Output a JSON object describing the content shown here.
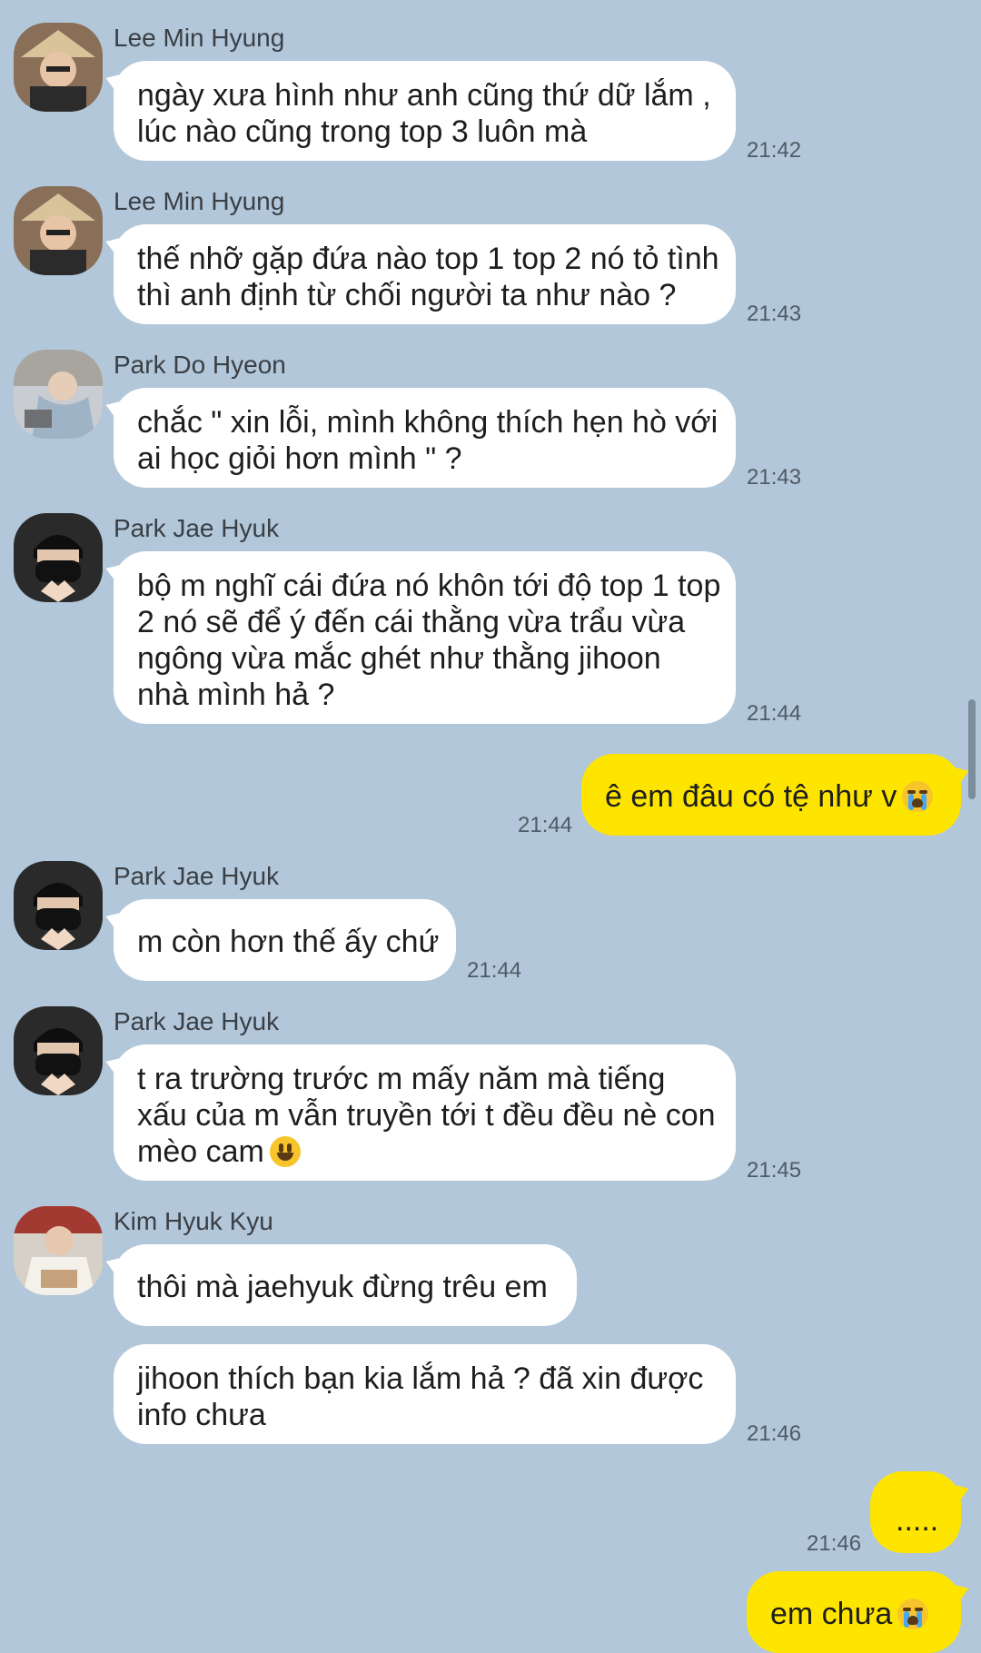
{
  "messages": [
    {
      "sender": "Lee Min Hyung",
      "lines": [
        "ngày xưa hình như anh cũng thứ dữ lắm ,",
        "lúc nào cũng trong top 3 luôn mà"
      ],
      "time": "21:42"
    },
    {
      "sender": "Lee Min Hyung",
      "lines": [
        "thế nhỡ gặp đứa nào top 1 top 2 nó tỏ tình",
        "thì anh định từ chối người ta như nào ?"
      ],
      "time": "21:43"
    },
    {
      "sender": "Park Do Hyeon",
      "lines": [
        "chắc \" xin lỗi, mình không thích hẹn hò với",
        "ai học giỏi hơn mình \" ?"
      ],
      "time": "21:43"
    },
    {
      "sender": "Park Jae Hyuk",
      "lines": [
        "bộ m nghĩ cái đứa nó khôn tới độ top 1 top",
        "2 nó sẽ để ý đến cái thằng vừa trẩu vừa",
        "ngông vừa mắc ghét như thằng jihoon",
        "nhà mình hả ?"
      ],
      "time": "21:44"
    },
    {
      "me": true,
      "text": "ê em đâu có tệ như v",
      "emoji": "crying-face-emoji",
      "time": "21:44"
    },
    {
      "sender": "Park Jae Hyuk",
      "lines": [
        "m còn hơn thế ấy chứ"
      ],
      "time": "21:44"
    },
    {
      "sender": "Park Jae Hyuk",
      "lines": [
        "t ra trường trước m mấy năm mà tiếng",
        "xấu của m vẫn truyền tới t đều đều nè con",
        "mèo cam"
      ],
      "emoji": "smiling-face-emoji",
      "time": "21:45"
    },
    {
      "sender": "Kim Hyuk Kyu",
      "lines": [
        "thôi mà jaehyuk đừng trêu em"
      ]
    },
    {
      "lines": [
        "jihoon thích bạn kia lắm hả ? đã xin được",
        "info chưa"
      ],
      "time": "21:46"
    },
    {
      "me": true,
      "text": ".....",
      "time": "21:46"
    },
    {
      "me": true,
      "text": "em chưa",
      "emoji": "crying-face-emoji"
    }
  ],
  "colors": {
    "background": "#b2c7d9",
    "incoming": "#ffffff",
    "outgoing": "#fee500"
  }
}
